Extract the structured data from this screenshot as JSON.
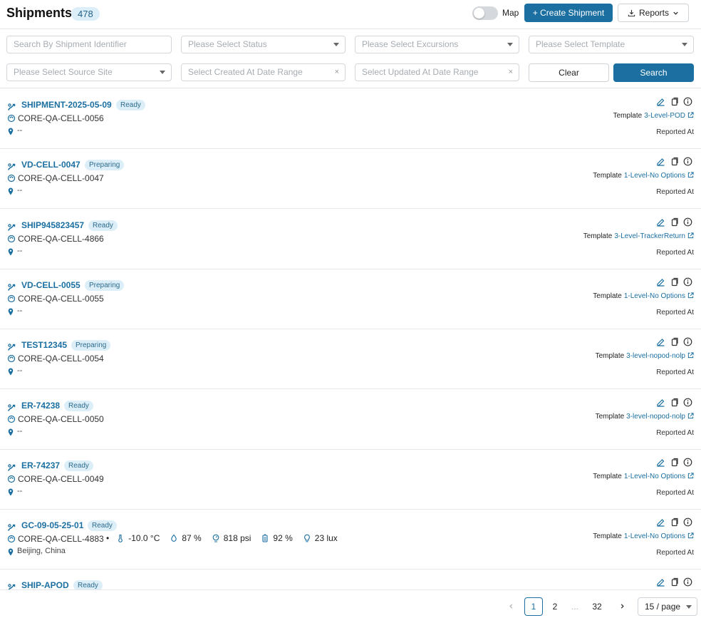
{
  "header": {
    "title": "Shipments",
    "count": "478",
    "map_label": "Map",
    "create_label": "+ Create Shipment",
    "reports_label": "Reports"
  },
  "filters": {
    "search_placeholder": "Search By Shipment Identifier",
    "status_placeholder": "Please Select Status",
    "excursions_placeholder": "Please Select Excursions",
    "template_placeholder": "Please Select Template",
    "source_site_placeholder": "Please Select Source Site",
    "created_placeholder": "Select Created At Date Range",
    "updated_placeholder": "Select Updated At Date Range",
    "clear_label": "Clear",
    "search_label": "Search"
  },
  "labels": {
    "template": "Template",
    "reported_at": "Reported At"
  },
  "shipments": [
    {
      "id": "SHIPMENT-2025-05-09",
      "status": "Ready",
      "device": "CORE-QA-CELL-0056",
      "location": "--",
      "template": "3-Level-POD"
    },
    {
      "id": "VD-CELL-0047",
      "status": "Preparing",
      "device": "CORE-QA-CELL-0047",
      "location": "--",
      "template": "1-Level-No Options"
    },
    {
      "id": "SHIP945823457",
      "status": "Ready",
      "device": "CORE-QA-CELL-4866",
      "location": "--",
      "template": "3-Level-TrackerReturn"
    },
    {
      "id": "VD-CELL-0055",
      "status": "Preparing",
      "device": "CORE-QA-CELL-0055",
      "location": "--",
      "template": "1-Level-No Options"
    },
    {
      "id": "TEST12345",
      "status": "Preparing",
      "device": "CORE-QA-CELL-0054",
      "location": "--",
      "template": "3-level-nopod-nolp"
    },
    {
      "id": "ER-74238",
      "status": "Ready",
      "device": "CORE-QA-CELL-0050",
      "location": "--",
      "template": "3-level-nopod-nolp"
    },
    {
      "id": "ER-74237",
      "status": "Ready",
      "device": "CORE-QA-CELL-0049",
      "location": "--",
      "template": "1-Level-No Options"
    },
    {
      "id": "GC-09-05-25-01",
      "status": "Ready",
      "device": "CORE-QA-CELL-4883",
      "location": "Beijing, China",
      "template": "1-Level-No Options",
      "sensors": {
        "temperature": "-10.0 °C",
        "humidity": "87 %",
        "pressure": "818 psi",
        "battery": "92 %",
        "light": "23 lux"
      }
    },
    {
      "id": "SHIP-APOD",
      "status": "Ready"
    }
  ],
  "pagination": {
    "pages": [
      "1",
      "2",
      "...",
      "32"
    ],
    "current": "1",
    "page_size": "15 / page"
  },
  "colors": {
    "primary": "#1b6fa1",
    "badge_bg": "#dceef7"
  }
}
